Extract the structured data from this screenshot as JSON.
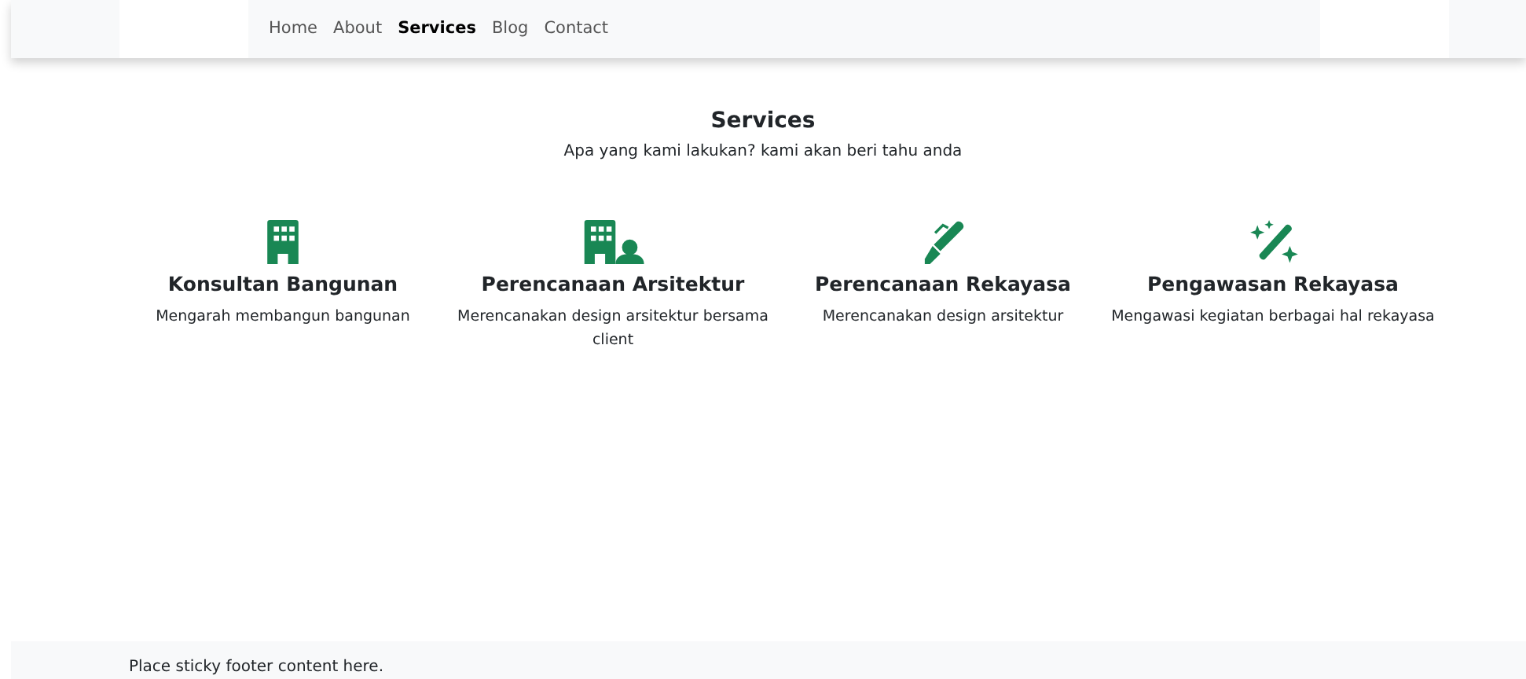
{
  "nav": [
    {
      "label": "Home",
      "selected": false
    },
    {
      "label": "About",
      "selected": false
    },
    {
      "label": "Services",
      "selected": true
    },
    {
      "label": "Blog",
      "selected": false
    },
    {
      "label": "Contact",
      "selected": false
    }
  ],
  "section": {
    "title": "Services",
    "subtitle": "Apa yang kami lakukan? kami akan beri tahu anda"
  },
  "services": [
    {
      "title": "Konsultan Bangunan",
      "text": "Mengarah membangun bangunan"
    },
    {
      "title": "Perencanaan Arsitektur",
      "text": "Merencanakan design arsitektur bersama client"
    },
    {
      "title": "Perencanaan Rekayasa",
      "text": "Merencanakan design arsitektur"
    },
    {
      "title": "Pengawasan Rekayasa",
      "text": "Mengawasi kegiatan berbagai hal rekayasa"
    }
  ],
  "footer": {
    "text": "Place sticky footer content here."
  }
}
